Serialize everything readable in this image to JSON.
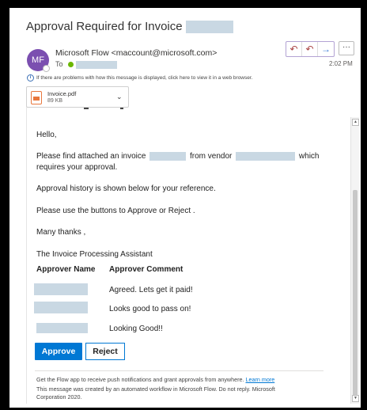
{
  "header": {
    "subject": "Approval Required for Invoice",
    "avatar_initials": "MF",
    "from": "Microsoft Flow <maccount@microsoft.com>",
    "to_label": "To",
    "time": "2:02 PM",
    "info_text": "If there are problems with how this message is displayed, click here to view it in a web browser.",
    "actions": {
      "reply": "↶",
      "reply_all": "↶",
      "forward": "→",
      "more": "···"
    }
  },
  "attachment": {
    "name": "Invoice.pdf",
    "size": "89 KB"
  },
  "body": {
    "greeting": "Hello,",
    "line1a": "Please find attached an invoice",
    "line1b": "from vendor",
    "line1c": "which",
    "line1d": "requires your approval.",
    "line2": "Approval history is shown below for your reference.",
    "line3": "Please use the buttons to Approve or Reject .",
    "line4": "Many thanks ,",
    "line5": "The Invoice Processing Assistant"
  },
  "table": {
    "headers": [
      "Approver Name",
      "Approver Comment"
    ],
    "rows": [
      {
        "comment": "Agreed. Lets get it paid!"
      },
      {
        "comment": "Looks good to pass on!"
      },
      {
        "comment": "Looking Good!!"
      }
    ]
  },
  "buttons": {
    "approve": "Approve",
    "reject": "Reject"
  },
  "footer": {
    "line1": "Get the Flow app to receive push notifications and grant approvals from anywhere.",
    "link": "Learn more",
    "line2": "This message was created by an automated workflow in Microsoft Flow. Do not reply. Microsoft",
    "line3": "Corporation 2020."
  },
  "colors": {
    "accent": "#0078d4",
    "avatar": "#7b4fb0",
    "redaction": "#c9d8e3"
  }
}
